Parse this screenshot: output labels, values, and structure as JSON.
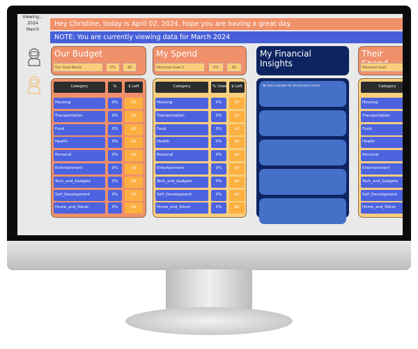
{
  "sidebar": {
    "viewing": "Viewing...",
    "year": "2024",
    "month": "March"
  },
  "greeting": "Hey Christine, today is April 02, 2024, hope you are having a great day.",
  "note": "NOTE: You are currently viewing data for March 2024",
  "categories": [
    "Housing",
    "Transportation",
    "Food",
    "Health",
    "Personal",
    "Entertainment",
    "Tech_and_Gadgets",
    "Self_Development",
    "Home_and_Décor"
  ],
  "budget": {
    "title": "Our Budget",
    "goal_name": "Our Goal Name",
    "goal_pct": "0%",
    "goal_amount": "$0",
    "headers": [
      "Category",
      "%",
      "$ Left"
    ],
    "pct": "0%",
    "left": "$0"
  },
  "spend": {
    "title": "My Spend",
    "goal_name": "Personal Goal 2",
    "goal_pct": "0%",
    "goal_amount": "$0",
    "headers": [
      "Category",
      "% Used",
      "$ Left"
    ],
    "pct": "0%",
    "left": "$0"
  },
  "insights": {
    "title": "My Financial Insights",
    "messages": [
      "No data available for the previous month",
      "",
      "",
      "",
      ""
    ]
  },
  "their": {
    "title": "Their Spend",
    "goal_name": "Personal Goal",
    "headers": [
      "Category"
    ]
  },
  "colors": {
    "orange": "#f0906a",
    "blue": "#4c63e0",
    "navy": "#0d2461",
    "yellow": "#f9cf7c",
    "amber": "#fbb040"
  }
}
